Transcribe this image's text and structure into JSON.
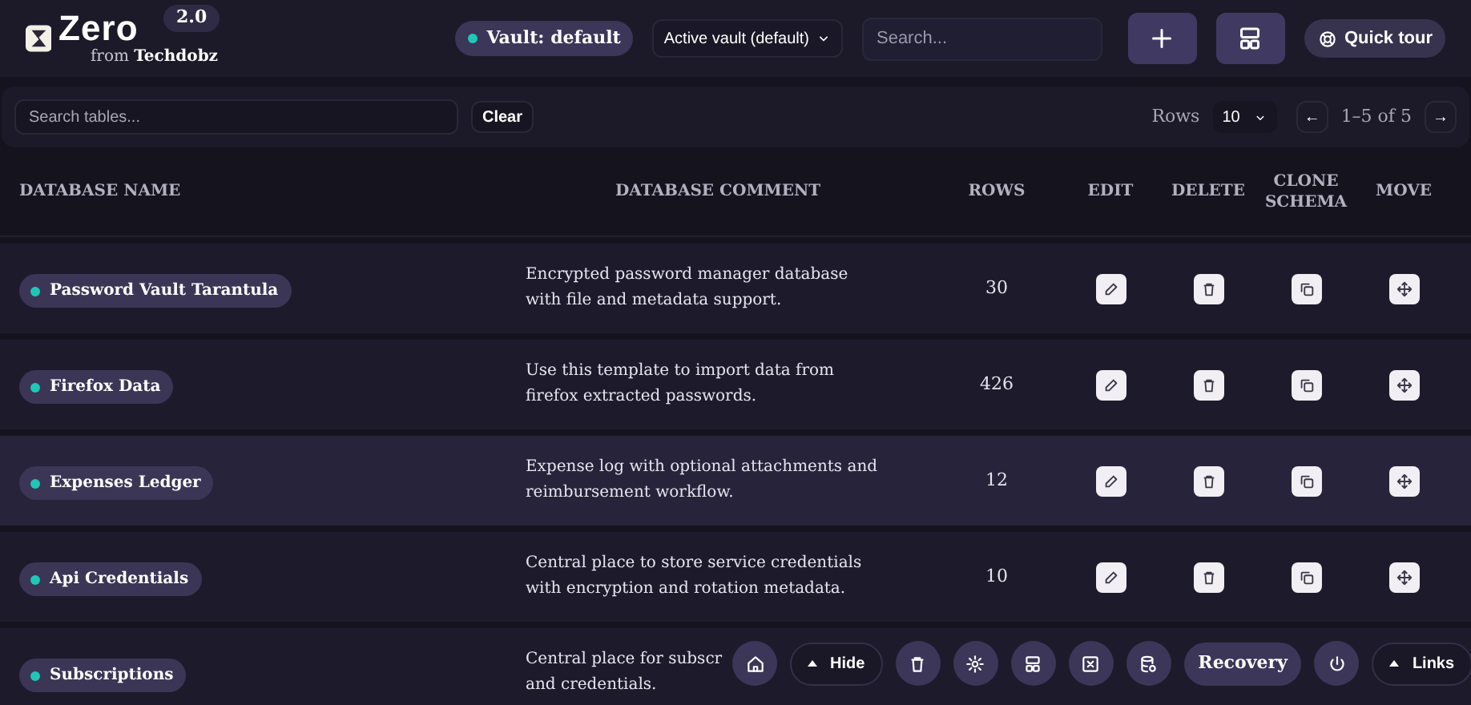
{
  "header": {
    "logo_text": "Zero",
    "version": "2.0",
    "byline_prefix": "from",
    "byline_brand": "Techdobz",
    "vault_badge": "Vault: default",
    "vault_select": "Active vault (default)",
    "search": {
      "placeholder": "Search..."
    },
    "quick_tour": "Quick tour"
  },
  "toolbar": {
    "search": {
      "placeholder": "Search tables..."
    },
    "clear": "Clear",
    "rows_label": "Rows",
    "rows_select": "10",
    "prev": "←",
    "range": "1–5 of 5",
    "next": "→"
  },
  "table": {
    "columns": [
      "DATABASE NAME",
      "DATABASE COMMENT",
      "ROWS",
      "EDIT",
      "DELETE",
      "CLONE SCHEMA",
      "MOVE"
    ],
    "rows": [
      {
        "name": "Password Vault Tarantula",
        "comment_lines": [
          "Encrypted password manager database",
          "with file and metadata support."
        ],
        "rows": "30",
        "selected": false
      },
      {
        "name": "Firefox Data",
        "comment_lines": [
          "Use this template to import data from",
          "firefox extracted passwords."
        ],
        "rows": "426",
        "selected": false
      },
      {
        "name": "Expenses Ledger",
        "comment_lines": [
          "Expense log with optional attachments and",
          "reimbursement workflow."
        ],
        "rows": "12",
        "selected": true
      },
      {
        "name": "Api Credentials",
        "comment_lines": [
          "Central place to store service credentials",
          "with encryption and rotation metadata."
        ],
        "rows": "10",
        "selected": false
      },
      {
        "name": "Subscriptions",
        "comment_lines": [
          "Central place for subscr",
          "and credentials."
        ],
        "selected": false
      }
    ]
  },
  "dock": [
    {
      "kind": "home"
    },
    {
      "kind": "toggle",
      "label": "Hide"
    },
    {
      "kind": "trash"
    },
    {
      "kind": "gear"
    },
    {
      "kind": "layout"
    },
    {
      "kind": "close"
    },
    {
      "kind": "database"
    },
    {
      "kind": "text",
      "label": "Recovery"
    },
    {
      "kind": "power"
    },
    {
      "kind": "toggle",
      "label": "Links"
    }
  ]
}
